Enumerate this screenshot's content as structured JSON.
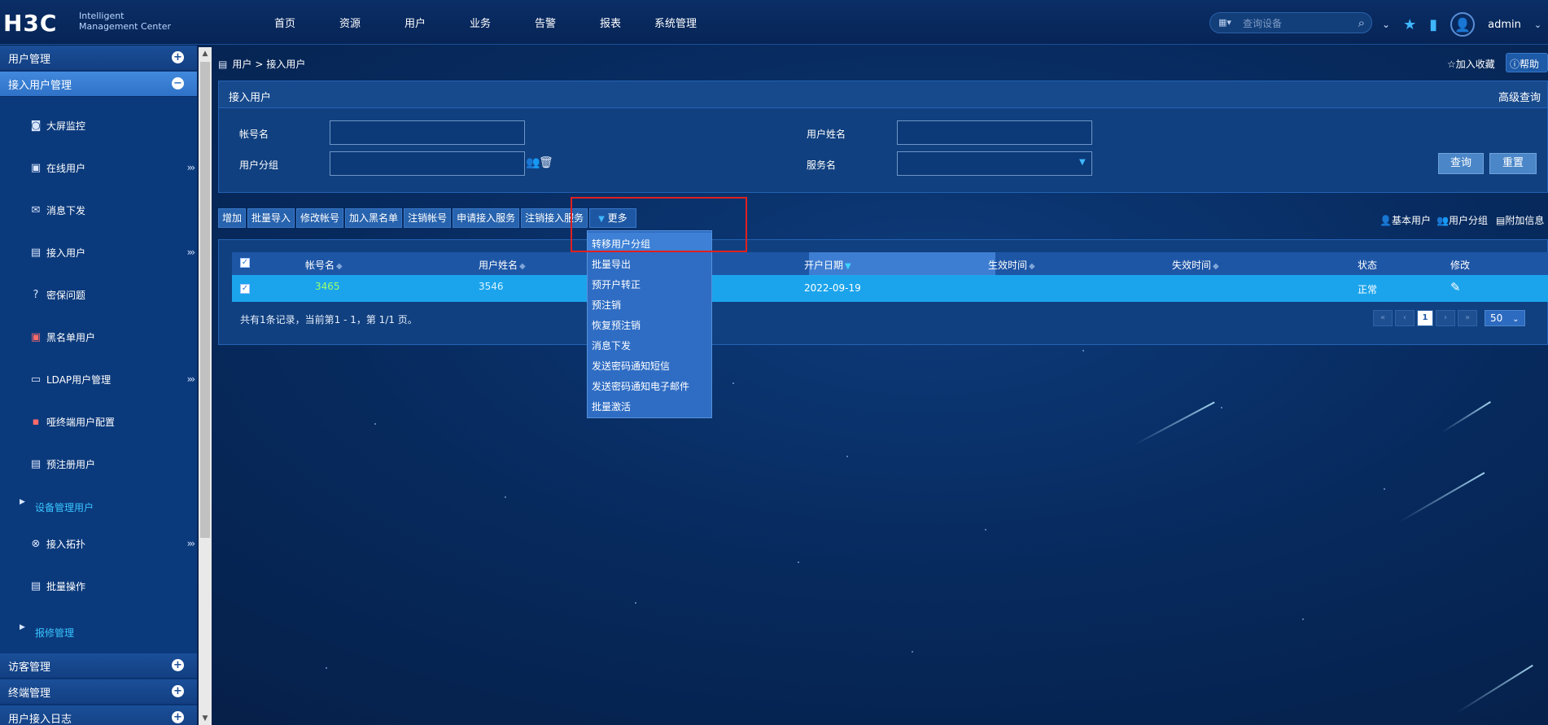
{
  "app": {
    "logo": "H3C",
    "logo_sub_1": "Intelligent",
    "logo_sub_2": "Management Center"
  },
  "topnav": [
    "首页",
    "资源",
    "用户",
    "业务",
    "告警",
    "报表",
    "系统管理"
  ],
  "search": {
    "placeholder": "查询设备"
  },
  "user": {
    "name": "admin"
  },
  "sidebar": {
    "sections": [
      {
        "label": "用户管理",
        "toggle": "+"
      },
      {
        "label": "接入用户管理",
        "toggle": "−"
      }
    ],
    "items": [
      {
        "label": "大屏监控",
        "icon": "monitor-icon",
        "has_more": false
      },
      {
        "label": "在线用户",
        "icon": "online-user-icon",
        "has_more": true
      },
      {
        "label": "消息下发",
        "icon": "message-icon",
        "has_more": false
      },
      {
        "label": "接入用户",
        "icon": "access-user-icon",
        "has_more": true
      },
      {
        "label": "密保问题",
        "icon": "question-icon",
        "has_more": false
      },
      {
        "label": "黑名单用户",
        "icon": "blacklist-icon",
        "has_more": false
      },
      {
        "label": "LDAP用户管理",
        "icon": "ldap-icon",
        "has_more": true
      },
      {
        "label": "哑终端用户配置",
        "icon": "dumb-terminal-icon",
        "has_more": false
      },
      {
        "label": "预注册用户",
        "icon": "preregister-icon",
        "has_more": false
      }
    ],
    "sub1": "设备管理用户",
    "items2": [
      {
        "label": "接入拓扑",
        "icon": "topology-icon",
        "has_more": true
      },
      {
        "label": "批量操作",
        "icon": "batch-icon",
        "has_more": false
      }
    ],
    "sub2": "报修管理",
    "bottom_sections": [
      {
        "label": "访客管理",
        "toggle": "+"
      },
      {
        "label": "终端管理",
        "toggle": "+"
      },
      {
        "label": "用户接入日志",
        "toggle": "+"
      }
    ]
  },
  "breadcrumb": {
    "root": "用户",
    "sep": ">",
    "current": "接入用户"
  },
  "actions": {
    "favorite": "加入收藏",
    "help": "帮助"
  },
  "query_panel": {
    "title": "接入用户",
    "advanced": "高级查询",
    "fields": {
      "account": {
        "label": "帐号名",
        "value": ""
      },
      "username": {
        "label": "用户姓名",
        "value": ""
      },
      "group": {
        "label": "用户分组",
        "value": ""
      },
      "service": {
        "label": "服务名",
        "value": ""
      }
    },
    "query_btn": "查询",
    "reset_btn": "重置"
  },
  "toolbar": {
    "buttons": [
      "增加",
      "批量导入",
      "修改帐号",
      "加入黑名单",
      "注销帐号",
      "申请接入服务",
      "注销接入服务"
    ],
    "more": "更多",
    "right": {
      "basic_user": "基本用户",
      "user_group": "用户分组",
      "extra_info": "附加信息"
    }
  },
  "dropdown": {
    "items": [
      "转移用户分组",
      "批量导出",
      "预开户转正",
      "预注销",
      "恢复预注销",
      "消息下发",
      "发送密码通知短信",
      "发送密码通知电子邮件",
      "批量激活"
    ]
  },
  "table": {
    "columns": [
      "帐号名",
      "用户姓名",
      "开户日期",
      "生效时间",
      "失效时间",
      "状态",
      "修改"
    ],
    "rows": [
      {
        "account": "3465",
        "name": "3546",
        "open_date": "2022-09-19",
        "effective": "",
        "expire": "",
        "status": "正常"
      }
    ],
    "footer": "共有1条记录，当前第1 - 1，第 1/1 页。",
    "page": "1",
    "page_size": "50"
  },
  "colors": {
    "background": "#072a5e",
    "sidebar": "#0b3a7c",
    "active_section": "#2f72c8",
    "selected_row": "#1ba4ec",
    "accent_cyan": "#39c4ff",
    "highlight_box": "#e02020"
  }
}
